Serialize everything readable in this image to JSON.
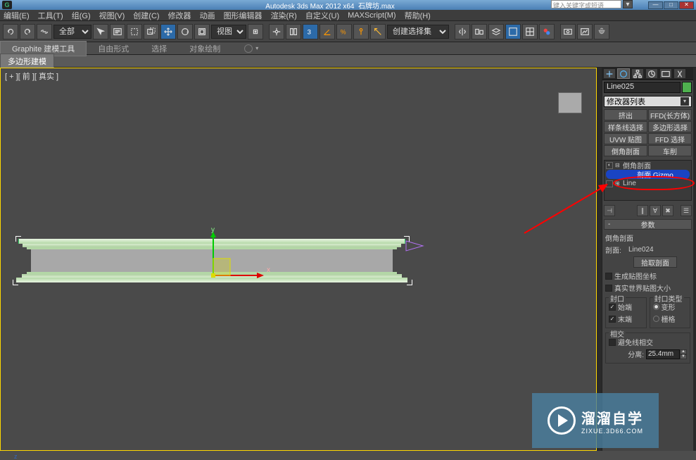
{
  "title": {
    "app": "Autodesk 3ds Max  2012 x64",
    "file": "石牌坊.max"
  },
  "search": {
    "placeholder": "键入关键字或短语"
  },
  "menus": [
    "编辑(E)",
    "工具(T)",
    "组(G)",
    "视图(V)",
    "创建(C)",
    "修改器",
    "动画",
    "图形编辑器",
    "渲染(R)",
    "自定义(U)",
    "MAXScript(M)",
    "帮助(H)"
  ],
  "toolbar": {
    "layer_select": "全部",
    "view_select": "视图",
    "named_sel": "创建选择集"
  },
  "ribbon": {
    "tabs": [
      "Graphite 建模工具",
      "自由形式",
      "选择",
      "对象绘制"
    ],
    "active": 0
  },
  "subribbon": {
    "tab": "多边形建模"
  },
  "viewport": {
    "label": "[ + ][ 前 ][ 真实 ]",
    "axis_x": "x",
    "axis_y": "y"
  },
  "command_panel": {
    "object_name": "Line025",
    "modifier_dropdown": "修改器列表",
    "mod_buttons": [
      "挤出",
      "FFD(长方体)",
      "样条线选择",
      "多边形选择",
      "UVW 贴图",
      "FFD 选择",
      "倒角剖面",
      "车削"
    ],
    "stack": {
      "top": "倒角剖面",
      "gizmo": "剖面 Gizmo",
      "base": "Line"
    },
    "rollout_title": "参数",
    "bevel": {
      "section_title": "倒角剖面",
      "profile_label": "剖面:",
      "profile_value": "Line024",
      "pick_btn": "拾取剖面",
      "gen_mapping": "生成贴图坐标",
      "real_world": "真实世界贴图大小"
    },
    "cap": {
      "group": "封口",
      "start": "始端",
      "end": "末端",
      "type_group": "封口类型",
      "morph": "变形",
      "grid": "栅格"
    },
    "intersect": {
      "group": "相交",
      "avoid": "避免线相交",
      "sep_label": "分离:",
      "sep_value": "25.4mm"
    }
  },
  "watermark": {
    "ch": "溜溜自学",
    "url": "ZIXUE.3D66.COM"
  },
  "status": {
    "coord": "z"
  }
}
